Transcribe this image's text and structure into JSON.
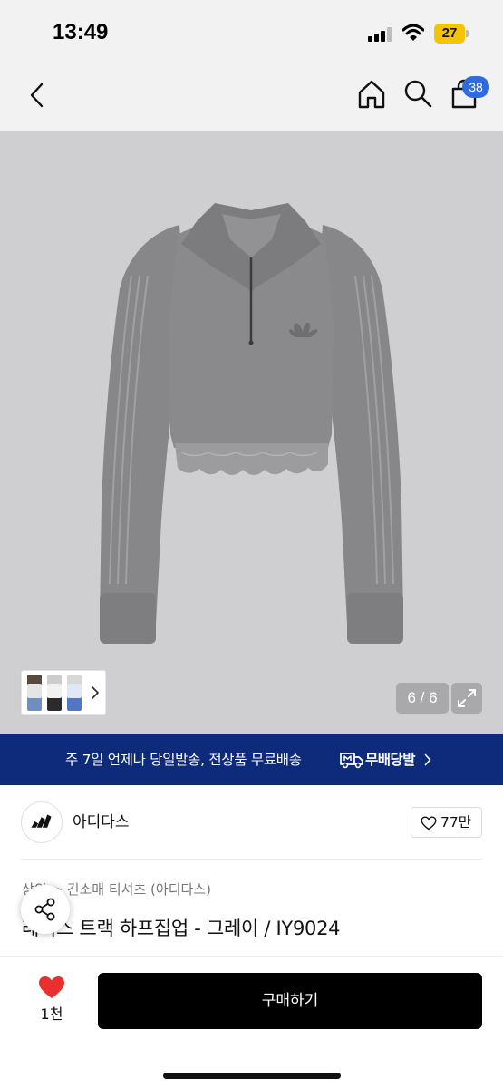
{
  "status_bar": {
    "time": "13:49",
    "battery_level": "27",
    "battery_color": "#f5c400",
    "icons": [
      "signal-icon",
      "wifi-icon",
      "battery-icon"
    ]
  },
  "nav": {
    "icons": [
      "back-icon",
      "home-icon",
      "search-icon",
      "cart-icon"
    ],
    "cart_count": "38",
    "badge_color": "#2f6bdc"
  },
  "gallery": {
    "page_counter": "6 / 6",
    "product_color": "#8a8a8c",
    "background_color": "#cfcfd2",
    "icons": [
      "thumbnail-chevron-icon",
      "expand-icon"
    ]
  },
  "promo": {
    "text": "주 7일 언제나 당일발송, 전상품 무료배송",
    "brand": "무배당발",
    "background_color": "#0e2a7a",
    "icons": [
      "delivery-truck-icon",
      "chevron-right-icon"
    ]
  },
  "brand": {
    "name": "아디다스",
    "like_count": "77만",
    "icons": [
      "adidas-logo-icon",
      "heart-outline-icon"
    ]
  },
  "product": {
    "category": "상의 > 긴소매 티셔츠 (아디다스)",
    "title": "레이스 트랙 하프집업 - 그레이 / IY9024"
  },
  "bottom_bar": {
    "wish_count": "1천",
    "buy_label": "구매하기",
    "heart_color": "#e8302f",
    "icons": [
      "share-icon",
      "heart-filled-icon"
    ]
  }
}
